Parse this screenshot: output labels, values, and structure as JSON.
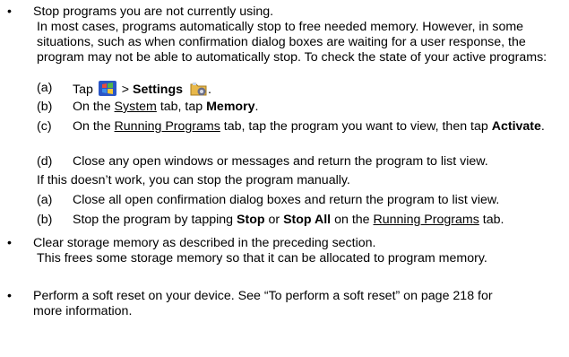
{
  "bullet_char": "•",
  "items": [
    {
      "text": "Stop programs you are not currently using.",
      "para1": "In most cases, programs automatically stop to free needed memory. However, in some situations, such as when confirmation dialog boxes are waiting for a user response, the program may not be able to automatically stop. To check the state of your active programs:",
      "steps_a": [
        {
          "label": "(a)",
          "pre": "Tap",
          "mid": ">",
          "bold": "Settings",
          "post": "."
        },
        {
          "label": "(b)",
          "pre": "On the",
          "u": "System",
          "mid": "tab, tap",
          "bold": "Memory",
          "post": "."
        },
        {
          "label": "(c)",
          "pre": "On the",
          "u": "Running Programs",
          "mid": "tab, tap the program you want to view, then tap",
          "bold": "Activate",
          "post": "."
        },
        {
          "label": "(d)",
          "text": "Close any open windows or messages and return the program to list view."
        }
      ],
      "para2": "If this doesn’t work, you can stop the program manually.",
      "steps_b": [
        {
          "label": "(a)",
          "text": "Close all open confirmation dialog boxes and return the program to list view."
        },
        {
          "label": "(b)",
          "pre": "Stop the program by tapping",
          "bold1": "Stop",
          "mid": "or",
          "bold2": "Stop All",
          "mid2": "on the",
          "u": "Running Programs",
          "post": "tab."
        }
      ]
    },
    {
      "text": "Clear storage memory as described in the preceding section.",
      "para": "This frees some storage memory so that it can be allocated to program memory."
    },
    {
      "text": "Perform a soft reset on your device. See “To perform a soft reset” on page 218 for more information."
    }
  ],
  "icons": {
    "start": "windows-start-icon",
    "settings": "settings-icon"
  }
}
